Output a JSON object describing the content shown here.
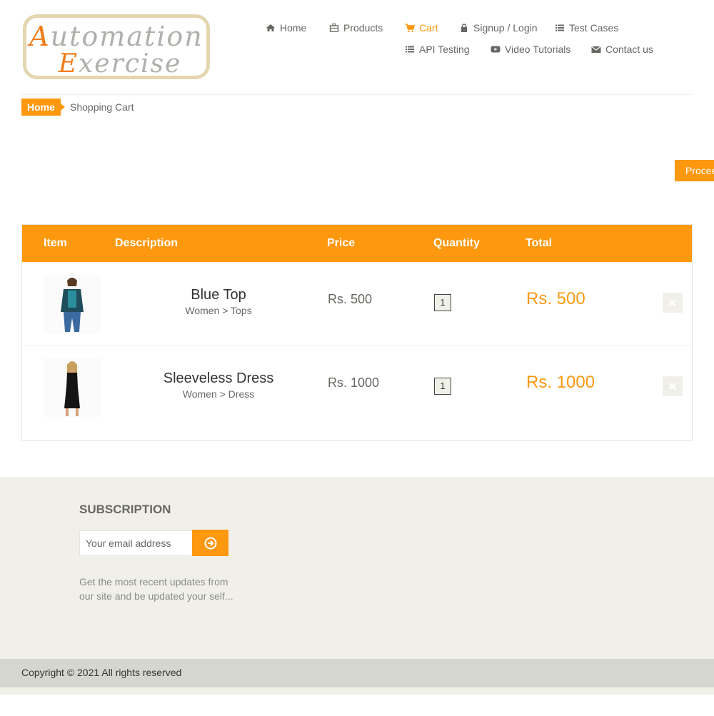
{
  "logo": {
    "line1_cap": "A",
    "line1_rest": "utomation",
    "line2_cap": "E",
    "line2_rest": "xercise"
  },
  "nav": {
    "items": [
      {
        "label": "Home",
        "icon": "home-icon"
      },
      {
        "label": "Products",
        "icon": "products-icon"
      },
      {
        "label": "Cart",
        "icon": "cart-icon",
        "active": true
      },
      {
        "label": "Signup / Login",
        "icon": "lock-icon"
      },
      {
        "label": "Test Cases",
        "icon": "list-icon"
      },
      {
        "label": "API Testing",
        "icon": "list-icon"
      },
      {
        "label": "Video Tutorials",
        "icon": "youtube-play-icon"
      },
      {
        "label": "Contact us",
        "icon": "envelope-icon"
      }
    ]
  },
  "breadcrumb": {
    "home": "Home",
    "current": "Shopping Cart"
  },
  "proceed_label": "Proceed To Checkout",
  "cart": {
    "headers": {
      "item": "Item",
      "description": "Description",
      "price": "Price",
      "quantity": "Quantity",
      "total": "Total"
    },
    "rows": [
      {
        "name": "Blue Top",
        "category": "Women > Tops",
        "price": "Rs. 500",
        "quantity": "1",
        "total": "Rs. 500",
        "delete_icon": "close-icon"
      },
      {
        "name": "Sleeveless Dress",
        "category": "Women > Dress",
        "price": "Rs. 1000",
        "quantity": "1",
        "total": "Rs. 1000",
        "delete_icon": "close-icon"
      }
    ]
  },
  "footer": {
    "subscription_title": "SUBSCRIPTION",
    "email_placeholder": "Your email address",
    "subscribe_icon": "arrow-circle-right-icon",
    "note": "Get the most recent updates from our site and be updated your self...",
    "copyright": "Copyright © 2021 All rights reserved"
  },
  "colors": {
    "accent": "#fe980f",
    "text": "#696763",
    "footer_bg": "#f0f0e9"
  }
}
